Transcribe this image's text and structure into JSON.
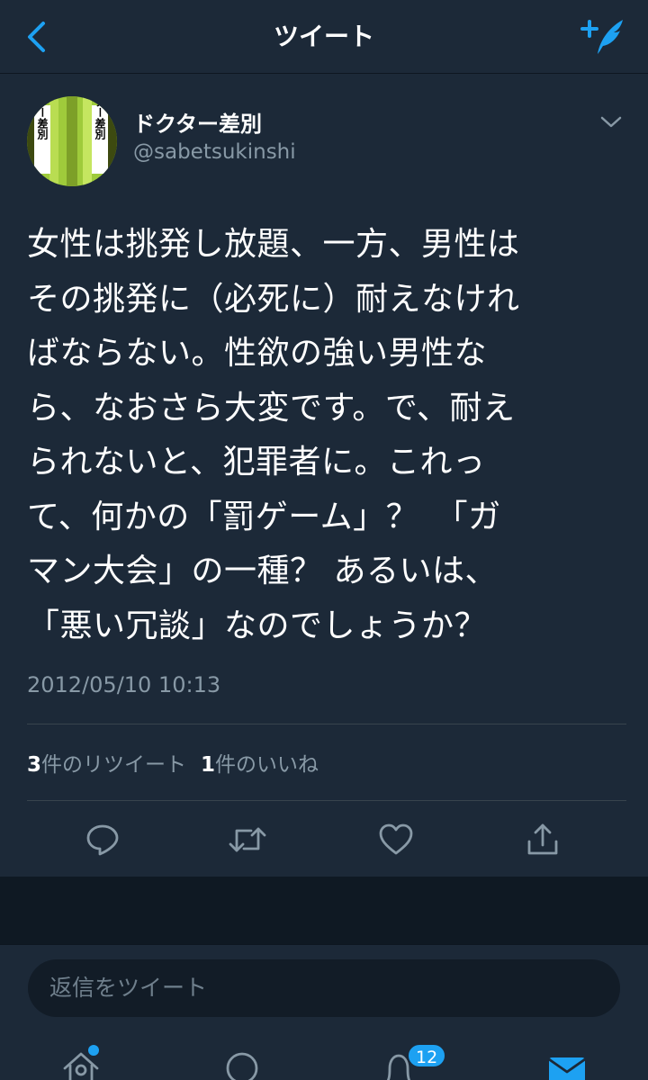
{
  "navbar": {
    "title": "ツイート",
    "back_icon": "chevron-left-icon",
    "compose_icon": "compose-tweet-icon"
  },
  "tweet": {
    "display_name": "ドクター差別",
    "handle": "@sabetsukinshi",
    "avatar_text": [
      "ドクター差別",
      "ドクター差別"
    ],
    "lines": [
      "女性は挑発し放題、一方、男性は",
      "その挑発に（必死に）耐えなけれ",
      "ばならない。性欲の強い男性な",
      "ら、なおさら大変です。で、耐え",
      "られないと、犯罪者に。これっ",
      "て、何かの「罰ゲーム」？　「ガ",
      "マン大会」の一種？ あるいは、",
      "「悪い冗談」なのでしょうか？"
    ],
    "timestamp": "2012/05/10 10:13",
    "retweet_count": "3",
    "retweet_label": "件のリツイート",
    "like_count": "1",
    "like_label": "件のいいね"
  },
  "reply": {
    "placeholder": "返信をツイート"
  },
  "tabbar": {
    "notifications_badge": "12"
  },
  "colors": {
    "background": "#1c2938",
    "accent": "#1da1f2",
    "secondary_text": "#8899a6"
  }
}
